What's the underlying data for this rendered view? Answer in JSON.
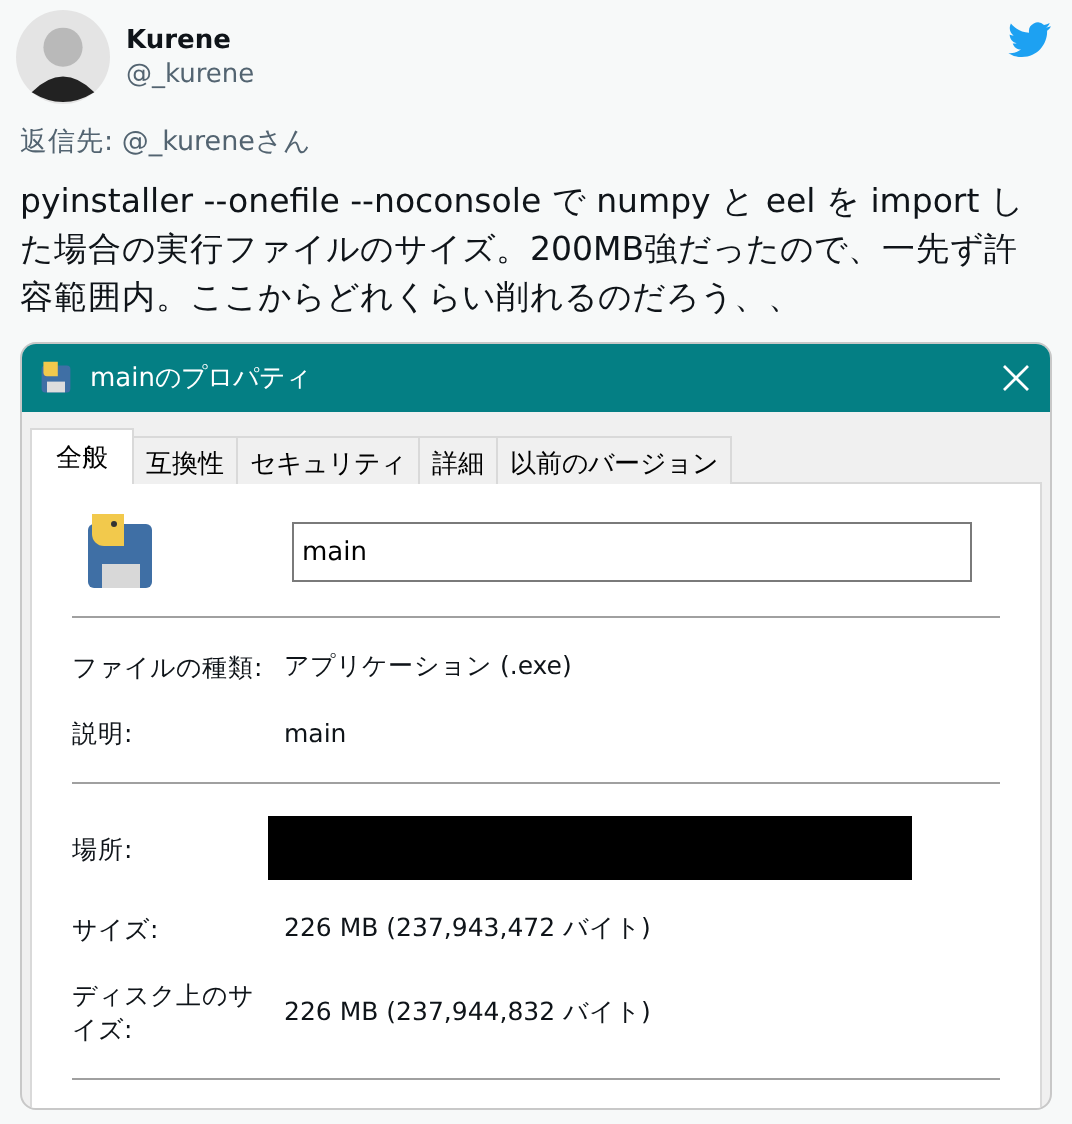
{
  "tweet": {
    "author": "Kurene",
    "handle": "@_kurene",
    "reply_to": "返信先: @_kureneさん",
    "text": "pyinstaller --onefile --noconsole で numpy と eel を import した場合の実行ファイルのサイズ。200MB強だったので、一先ず許容範囲内。ここからどれくらい削れるのだろう、、"
  },
  "dialog": {
    "title": "mainのプロパティ",
    "tabs": [
      {
        "label": "全般",
        "selected": true
      },
      {
        "label": "互換性",
        "selected": false
      },
      {
        "label": "セキュリティ",
        "selected": false
      },
      {
        "label": "詳細",
        "selected": false
      },
      {
        "label": "以前のバージョン",
        "selected": false
      }
    ],
    "file_name": "main",
    "groups": [
      [
        {
          "kind": "text",
          "label": "ファイルの種類:",
          "value": "アプリケーション (.exe)"
        },
        {
          "kind": "text",
          "label": "説明:",
          "value": "main"
        }
      ],
      [
        {
          "kind": "redacted",
          "label": "場所:"
        },
        {
          "kind": "text",
          "label": "サイズ:",
          "value": "226 MB (237,943,472 バイト)"
        },
        {
          "kind": "text",
          "label": "ディスク上のサイズ:",
          "value": "226 MB (237,944,832 バイト)"
        }
      ]
    ]
  }
}
